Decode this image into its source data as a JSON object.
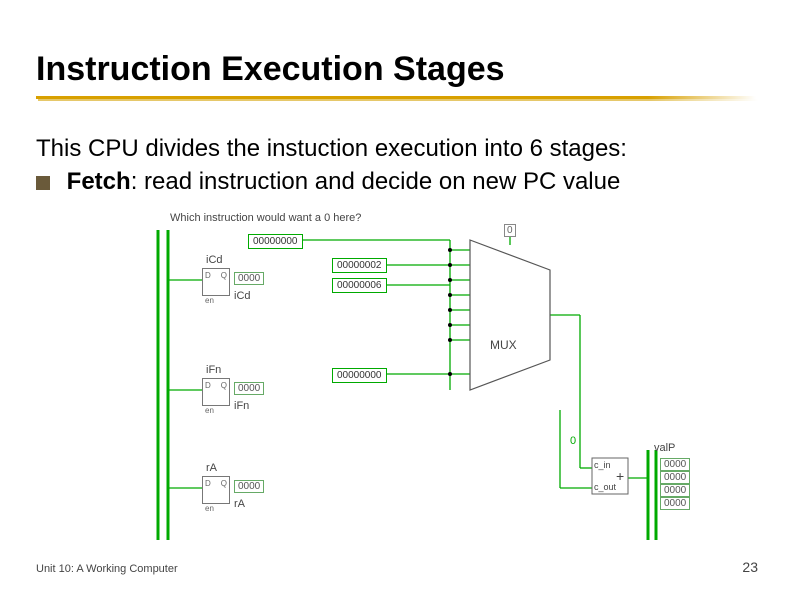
{
  "title": "Instruction Execution Stages",
  "body": {
    "line1": "This CPU divides the instuction execution into 6 stages:",
    "bullet_label": "Fetch",
    "bullet_rest": ": read instruction and decide on new PC value"
  },
  "diagram": {
    "question": "Which instruction would want a 0 here?",
    "const_top": "00000000",
    "mux_inputs": [
      "00000002",
      "00000006",
      "00000000"
    ],
    "mux_label": "MUX",
    "mux_out_zero": "0",
    "ff": [
      {
        "name": "iCd",
        "value": "0000"
      },
      {
        "name": "iFn",
        "value": "0000"
      },
      {
        "name": "rA",
        "value": "0000"
      }
    ],
    "adder": {
      "a": "c_in",
      "b": "c_out",
      "sym": "+"
    },
    "valp_label": "valP",
    "valp_bytes": [
      "0000",
      "0000",
      "0000",
      "0000"
    ]
  },
  "footer": {
    "left": "Unit 10: A Working Computer",
    "right": "23"
  }
}
